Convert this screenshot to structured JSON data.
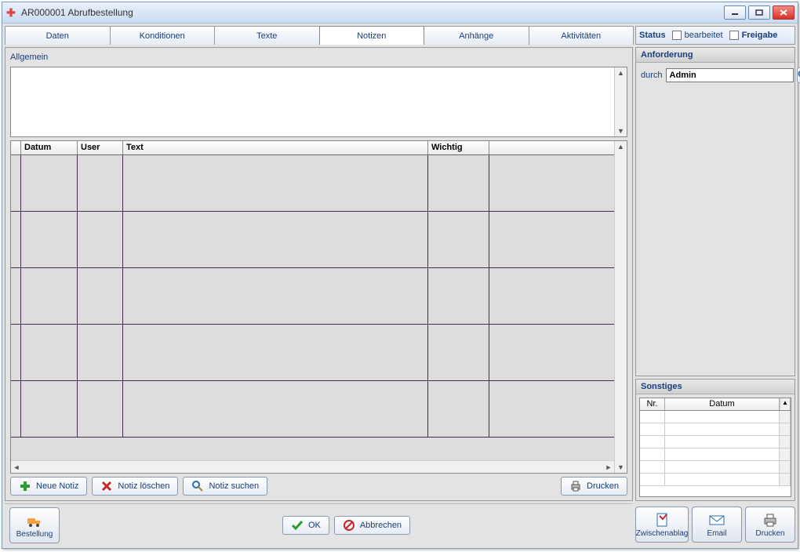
{
  "window": {
    "title": "AR000001 Abrufbestellung"
  },
  "tabs": [
    "Daten",
    "Konditionen",
    "Texte",
    "Notizen",
    "Anhänge",
    "Aktivitäten"
  ],
  "active_tab": 3,
  "general_label": "Allgemein",
  "general_text": "",
  "notes_table": {
    "columns": [
      "Datum",
      "User",
      "Text",
      "Wichtig"
    ]
  },
  "note_buttons": {
    "new": "Neue Notiz",
    "delete": "Notiz löschen",
    "search": "Notiz suchen",
    "print": "Drucken"
  },
  "action_buttons": {
    "ok": "OK",
    "cancel": "Abbrechen"
  },
  "bottom": {
    "order": "Bestellung",
    "clipboard": "Zwischenablag",
    "email": "Email",
    "print": "Drucken"
  },
  "status": {
    "label": "Status",
    "edited": "bearbeitet",
    "release": "Freigabe"
  },
  "anforderung": {
    "header": "Anforderung",
    "by_label": "durch",
    "by_value": "Admin"
  },
  "sonstiges": {
    "header": "Sonstiges",
    "columns": [
      "Nr.",
      "Datum"
    ]
  }
}
